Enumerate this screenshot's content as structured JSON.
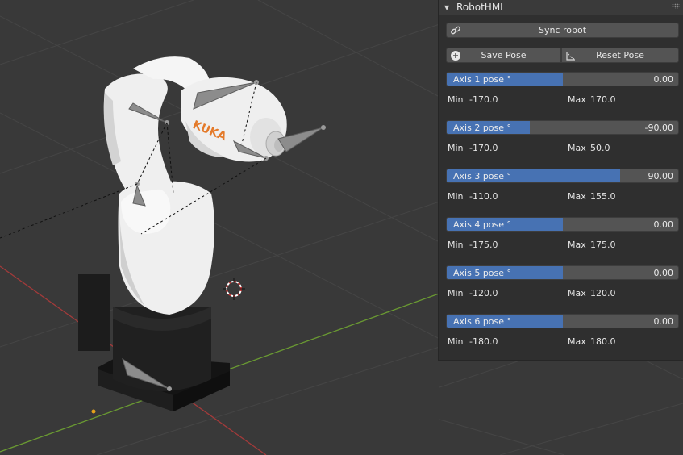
{
  "panel": {
    "title": "RobotHMI",
    "sync_label": "Sync robot",
    "save_label": "Save Pose",
    "reset_label": "Reset Pose",
    "min_label": "Min",
    "max_label": "Max"
  },
  "axes": [
    {
      "label": "Axis 1 pose °",
      "value": "0.00",
      "min": "-170.0",
      "max": "170.0",
      "fill_fraction": 0.5
    },
    {
      "label": "Axis 2 pose °",
      "value": "-90.00",
      "min": "-170.0",
      "max": "50.0",
      "fill_fraction": 0.36
    },
    {
      "label": "Axis 3 pose °",
      "value": "90.00",
      "min": "-110.0",
      "max": "155.0",
      "fill_fraction": 0.75
    },
    {
      "label": "Axis 4 pose °",
      "value": "0.00",
      "min": "-175.0",
      "max": "175.0",
      "fill_fraction": 0.5
    },
    {
      "label": "Axis 5 pose °",
      "value": "0.00",
      "min": "-120.0",
      "max": "120.0",
      "fill_fraction": 0.5
    },
    {
      "label": "Axis 6 pose °",
      "value": "0.00",
      "min": "-180.0",
      "max": "180.0",
      "fill_fraction": 0.5
    }
  ],
  "viewport": {
    "brand_text": "KUKA",
    "colors": {
      "background": "#393939",
      "x_axis": "#a33a3a",
      "y_axis": "#6a9a32",
      "robot": "#f2f2f2",
      "base": "#151515",
      "brand": "#e47a2a",
      "accent": "#4772b3"
    },
    "icons": [
      "link-icon",
      "plus-circle-icon",
      "reset-pose-icon",
      "3d-cursor-icon"
    ]
  }
}
